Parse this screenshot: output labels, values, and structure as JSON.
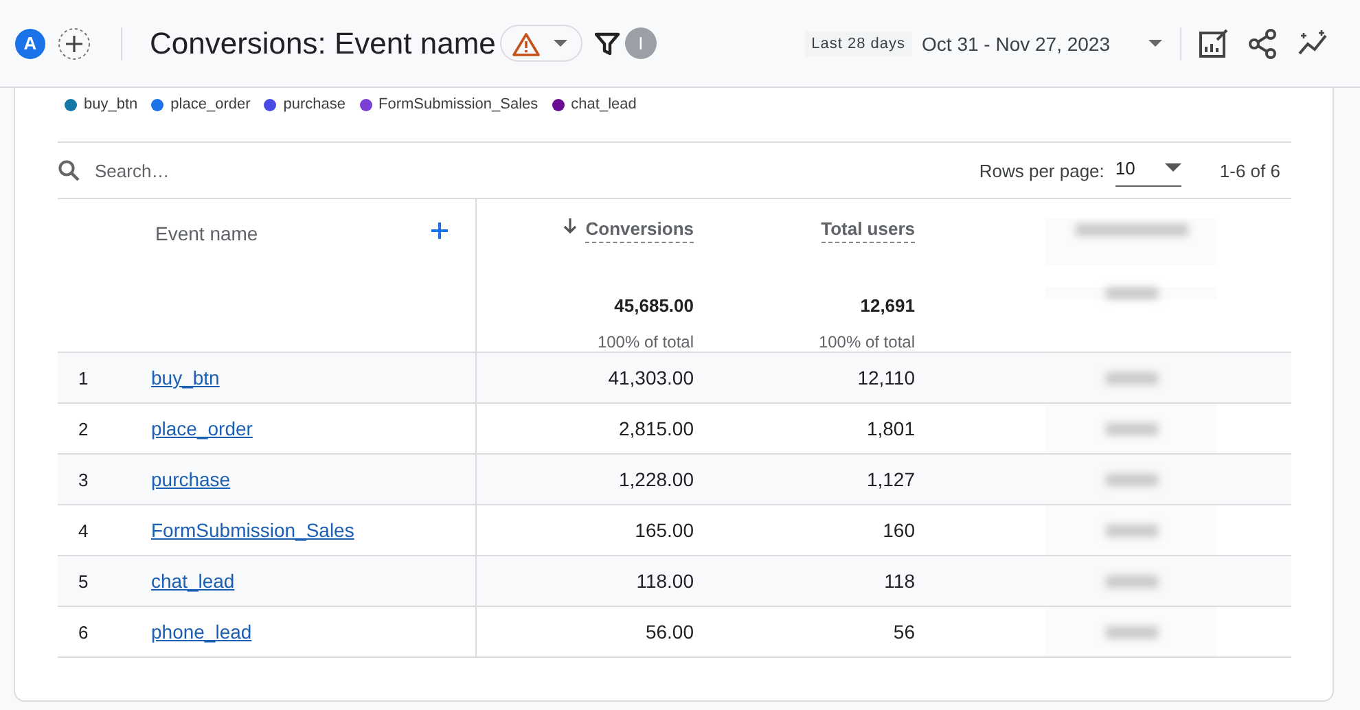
{
  "header": {
    "avatar": "A",
    "title": "Conversions: Event name",
    "warning": true,
    "filter_badge": "I",
    "date_chip": "Last 28 days",
    "date_range": "Oct 31 - Nov 27, 2023"
  },
  "legend": [
    {
      "label": "buy_btn",
      "color": "#1578a8"
    },
    {
      "label": "place_order",
      "color": "#1a73e8"
    },
    {
      "label": "purchase",
      "color": "#4a4ae4"
    },
    {
      "label": "FormSubmission_Sales",
      "color": "#7b3fd6"
    },
    {
      "label": "chat_lead",
      "color": "#6a0d91"
    }
  ],
  "toolbar": {
    "search_placeholder": "Search…",
    "rows_per_page_label": "Rows per page:",
    "rows_per_page": "10",
    "pagination": "1-6 of 6"
  },
  "table": {
    "columns": [
      {
        "label": "Event name",
        "kind": "dimension"
      },
      {
        "label": "Conversions",
        "kind": "metric",
        "sorted": true
      },
      {
        "label": "Total users",
        "kind": "metric",
        "sorted": false
      },
      {
        "kind": "blurred"
      }
    ],
    "totals": [
      {
        "value": "45,685.00",
        "share": "100% of total"
      },
      {
        "value": "12,691",
        "share": "100% of total"
      }
    ],
    "rows": [
      {
        "index": "1",
        "name": "buy_btn",
        "conversions": "41,303.00",
        "users": "12,110"
      },
      {
        "index": "2",
        "name": "place_order",
        "conversions": "2,815.00",
        "users": "1,801"
      },
      {
        "index": "3",
        "name": "purchase",
        "conversions": "1,228.00",
        "users": "1,127"
      },
      {
        "index": "4",
        "name": "FormSubmission_Sales",
        "conversions": "165.00",
        "users": "160"
      },
      {
        "index": "5",
        "name": "chat_lead",
        "conversions": "118.00",
        "users": "118"
      },
      {
        "index": "6",
        "name": "phone_lead",
        "conversions": "56.00",
        "users": "56"
      }
    ]
  }
}
